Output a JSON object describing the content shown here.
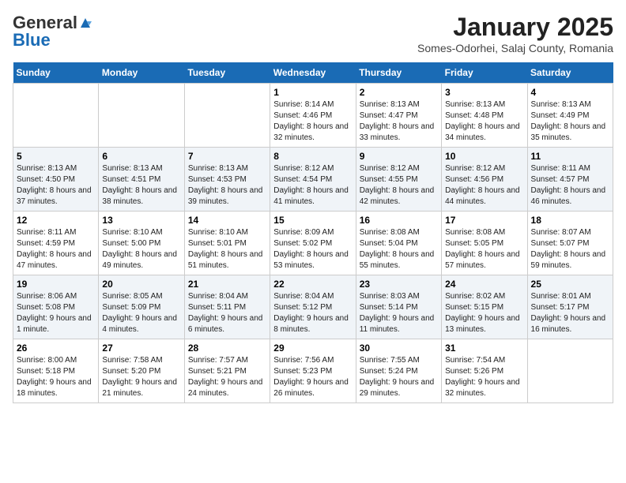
{
  "logo": {
    "general": "General",
    "blue": "Blue"
  },
  "title": "January 2025",
  "subtitle": "Somes-Odorhei, Salaj County, Romania",
  "days_of_week": [
    "Sunday",
    "Monday",
    "Tuesday",
    "Wednesday",
    "Thursday",
    "Friday",
    "Saturday"
  ],
  "weeks": [
    [
      {
        "day": "",
        "info": ""
      },
      {
        "day": "",
        "info": ""
      },
      {
        "day": "",
        "info": ""
      },
      {
        "day": "1",
        "info": "Sunrise: 8:14 AM\nSunset: 4:46 PM\nDaylight: 8 hours and 32 minutes."
      },
      {
        "day": "2",
        "info": "Sunrise: 8:13 AM\nSunset: 4:47 PM\nDaylight: 8 hours and 33 minutes."
      },
      {
        "day": "3",
        "info": "Sunrise: 8:13 AM\nSunset: 4:48 PM\nDaylight: 8 hours and 34 minutes."
      },
      {
        "day": "4",
        "info": "Sunrise: 8:13 AM\nSunset: 4:49 PM\nDaylight: 8 hours and 35 minutes."
      }
    ],
    [
      {
        "day": "5",
        "info": "Sunrise: 8:13 AM\nSunset: 4:50 PM\nDaylight: 8 hours and 37 minutes."
      },
      {
        "day": "6",
        "info": "Sunrise: 8:13 AM\nSunset: 4:51 PM\nDaylight: 8 hours and 38 minutes."
      },
      {
        "day": "7",
        "info": "Sunrise: 8:13 AM\nSunset: 4:53 PM\nDaylight: 8 hours and 39 minutes."
      },
      {
        "day": "8",
        "info": "Sunrise: 8:12 AM\nSunset: 4:54 PM\nDaylight: 8 hours and 41 minutes."
      },
      {
        "day": "9",
        "info": "Sunrise: 8:12 AM\nSunset: 4:55 PM\nDaylight: 8 hours and 42 minutes."
      },
      {
        "day": "10",
        "info": "Sunrise: 8:12 AM\nSunset: 4:56 PM\nDaylight: 8 hours and 44 minutes."
      },
      {
        "day": "11",
        "info": "Sunrise: 8:11 AM\nSunset: 4:57 PM\nDaylight: 8 hours and 46 minutes."
      }
    ],
    [
      {
        "day": "12",
        "info": "Sunrise: 8:11 AM\nSunset: 4:59 PM\nDaylight: 8 hours and 47 minutes."
      },
      {
        "day": "13",
        "info": "Sunrise: 8:10 AM\nSunset: 5:00 PM\nDaylight: 8 hours and 49 minutes."
      },
      {
        "day": "14",
        "info": "Sunrise: 8:10 AM\nSunset: 5:01 PM\nDaylight: 8 hours and 51 minutes."
      },
      {
        "day": "15",
        "info": "Sunrise: 8:09 AM\nSunset: 5:02 PM\nDaylight: 8 hours and 53 minutes."
      },
      {
        "day": "16",
        "info": "Sunrise: 8:08 AM\nSunset: 5:04 PM\nDaylight: 8 hours and 55 minutes."
      },
      {
        "day": "17",
        "info": "Sunrise: 8:08 AM\nSunset: 5:05 PM\nDaylight: 8 hours and 57 minutes."
      },
      {
        "day": "18",
        "info": "Sunrise: 8:07 AM\nSunset: 5:07 PM\nDaylight: 8 hours and 59 minutes."
      }
    ],
    [
      {
        "day": "19",
        "info": "Sunrise: 8:06 AM\nSunset: 5:08 PM\nDaylight: 9 hours and 1 minute."
      },
      {
        "day": "20",
        "info": "Sunrise: 8:05 AM\nSunset: 5:09 PM\nDaylight: 9 hours and 4 minutes."
      },
      {
        "day": "21",
        "info": "Sunrise: 8:04 AM\nSunset: 5:11 PM\nDaylight: 9 hours and 6 minutes."
      },
      {
        "day": "22",
        "info": "Sunrise: 8:04 AM\nSunset: 5:12 PM\nDaylight: 9 hours and 8 minutes."
      },
      {
        "day": "23",
        "info": "Sunrise: 8:03 AM\nSunset: 5:14 PM\nDaylight: 9 hours and 11 minutes."
      },
      {
        "day": "24",
        "info": "Sunrise: 8:02 AM\nSunset: 5:15 PM\nDaylight: 9 hours and 13 minutes."
      },
      {
        "day": "25",
        "info": "Sunrise: 8:01 AM\nSunset: 5:17 PM\nDaylight: 9 hours and 16 minutes."
      }
    ],
    [
      {
        "day": "26",
        "info": "Sunrise: 8:00 AM\nSunset: 5:18 PM\nDaylight: 9 hours and 18 minutes."
      },
      {
        "day": "27",
        "info": "Sunrise: 7:58 AM\nSunset: 5:20 PM\nDaylight: 9 hours and 21 minutes."
      },
      {
        "day": "28",
        "info": "Sunrise: 7:57 AM\nSunset: 5:21 PM\nDaylight: 9 hours and 24 minutes."
      },
      {
        "day": "29",
        "info": "Sunrise: 7:56 AM\nSunset: 5:23 PM\nDaylight: 9 hours and 26 minutes."
      },
      {
        "day": "30",
        "info": "Sunrise: 7:55 AM\nSunset: 5:24 PM\nDaylight: 9 hours and 29 minutes."
      },
      {
        "day": "31",
        "info": "Sunrise: 7:54 AM\nSunset: 5:26 PM\nDaylight: 9 hours and 32 minutes."
      },
      {
        "day": "",
        "info": ""
      }
    ]
  ]
}
